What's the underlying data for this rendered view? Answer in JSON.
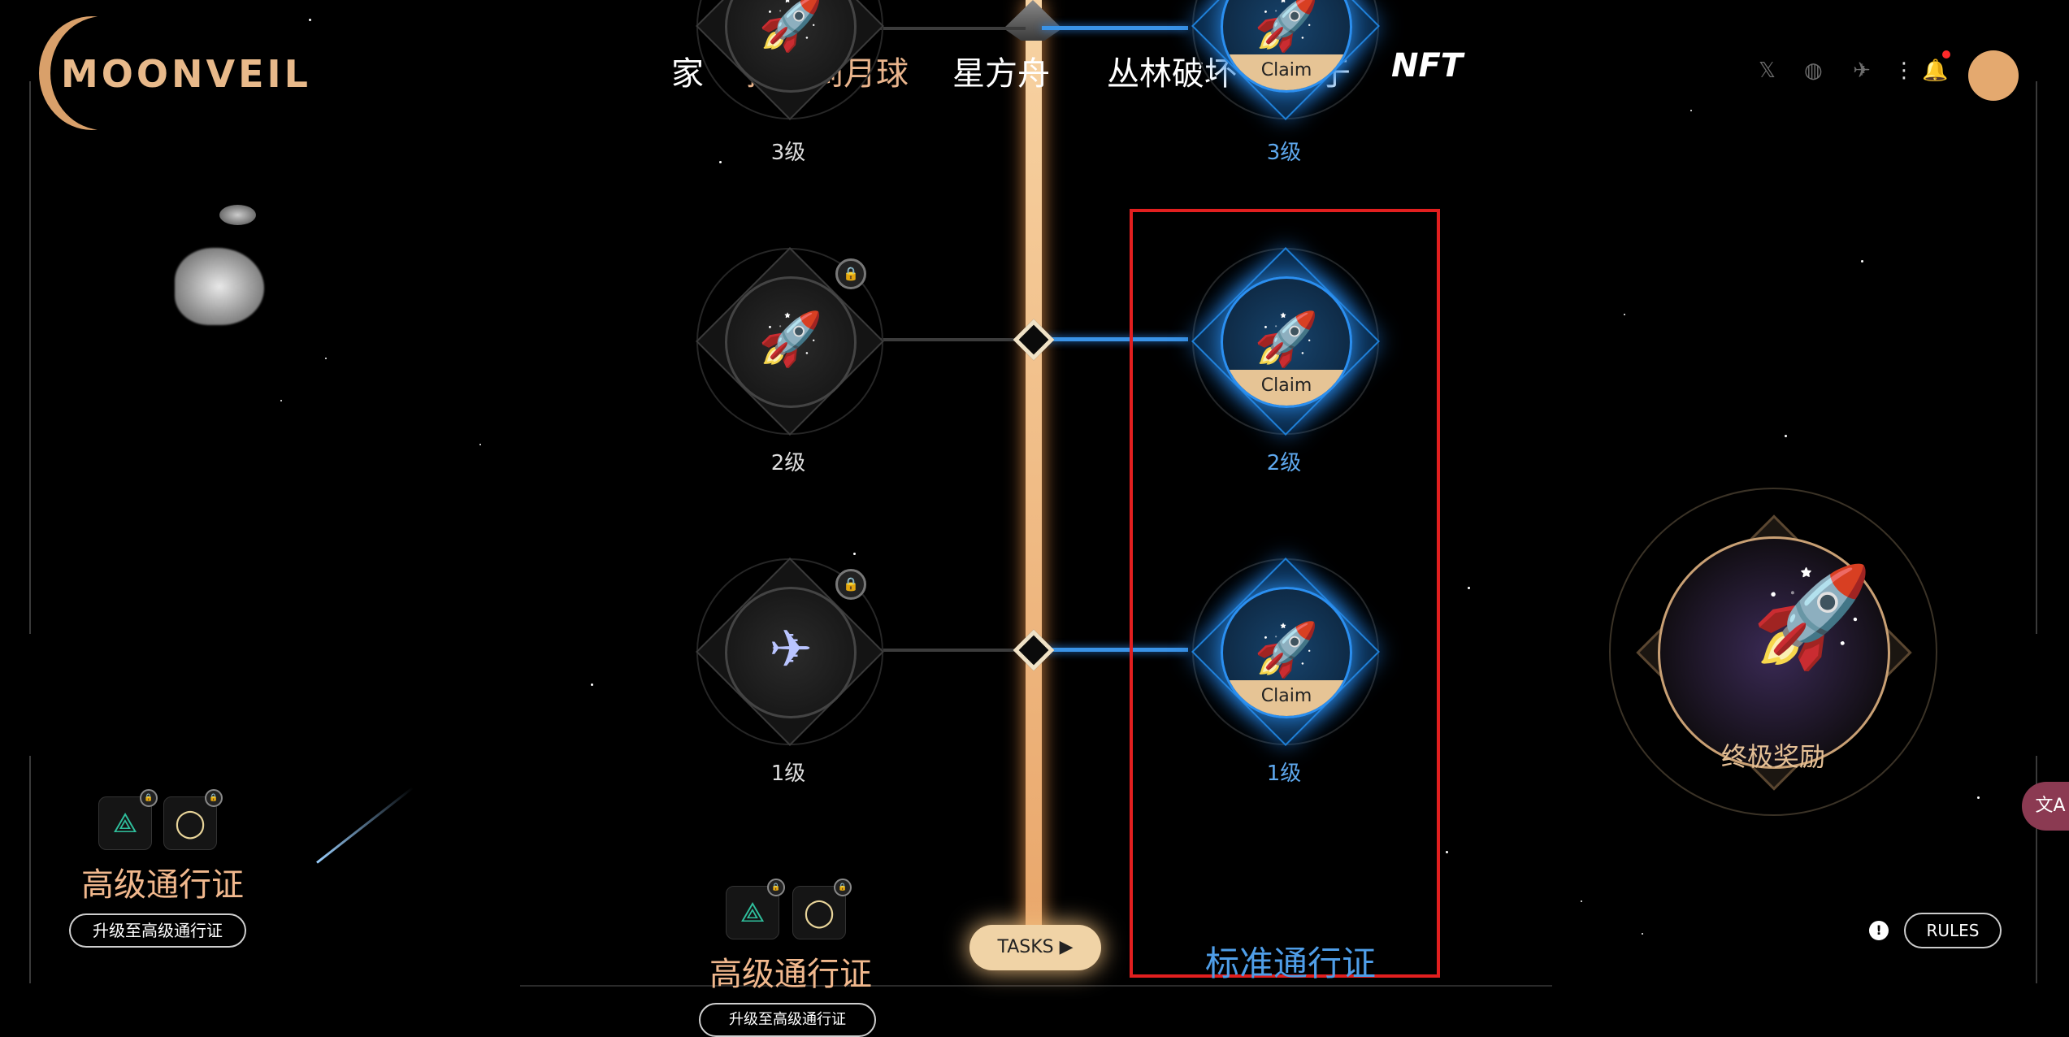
{
  "brand": {
    "logo_text": "MOONVEIL"
  },
  "nav": [
    {
      "label": "家",
      "active": false
    },
    {
      "label": "摇滚到月球",
      "active": true
    },
    {
      "label": "星方舟",
      "active": false
    },
    {
      "label": "丛林破坏",
      "active": false
    },
    {
      "label": "关于",
      "active": false
    },
    {
      "label": "NFT",
      "active": false
    }
  ],
  "social": {
    "x": "𝕏",
    "discord": "◍",
    "telegram": "✈",
    "more": "⋮",
    "bell": "🔔"
  },
  "colors": {
    "accent_gold": "#e9b48c",
    "accent_blue": "#3a93e6",
    "highlight_red": "#e21f1f"
  },
  "premium_track": {
    "levels": [
      {
        "label": "3级",
        "locked": false,
        "icon": "shuttle-icon"
      },
      {
        "label": "2级",
        "locked": true,
        "icon": "shuttle-icon"
      },
      {
        "label": "1级",
        "locked": true,
        "icon": "jet-icon"
      }
    ]
  },
  "standard_track": {
    "levels": [
      {
        "label": "3级",
        "claim": "Claim",
        "icon": "rocket-icon"
      },
      {
        "label": "2级",
        "claim": "Claim",
        "icon": "rocket-icon"
      },
      {
        "label": "1级",
        "claim": "Claim",
        "icon": "rocket-icon"
      }
    ]
  },
  "sidebar_left": {
    "pass_title": "高级通行证",
    "upgrade_button": "升级至高级通行证"
  },
  "bottom_center": {
    "premium_title": "高级通行证",
    "upgrade_button": "升级至高级通行证",
    "tasks_button": "TASKS",
    "standard_title": "标准通行证"
  },
  "ultimate_reward": {
    "label": "终极奖励"
  },
  "rules": {
    "label": "RULES",
    "info": "!"
  }
}
